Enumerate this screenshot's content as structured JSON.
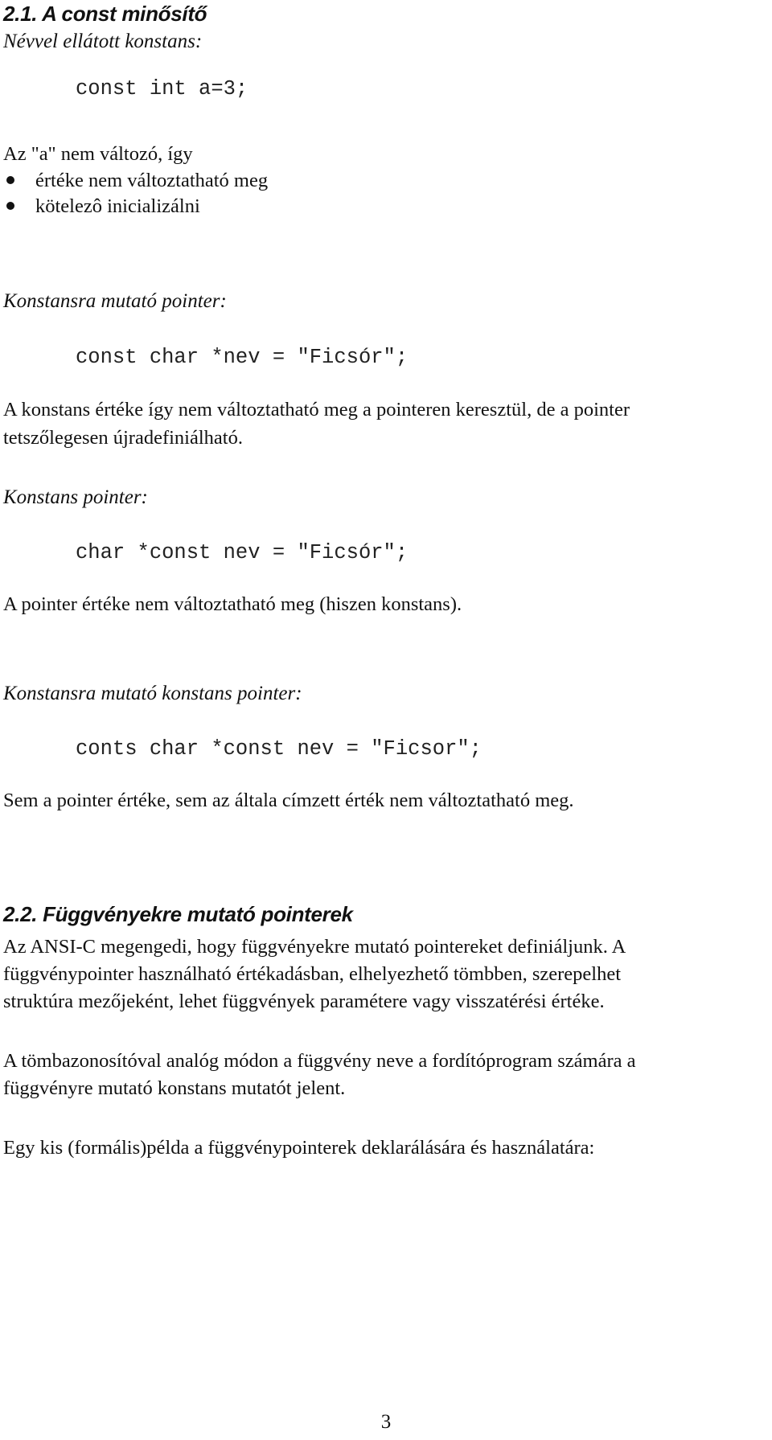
{
  "section1": {
    "heading": "2.1. A const minősítő",
    "named_constant": {
      "label": "Névvel ellátott konstans:",
      "code": "const int a=3;",
      "intro": "Az \"a\" nem változó, így",
      "bullets": [
        "értéke nem változtatható meg",
        "kötelezô inicializálni"
      ]
    },
    "pointer_to_constant": {
      "label": "Konstansra mutató pointer:",
      "code": "const char *nev = \"Ficsór\";",
      "text_line1": "A konstans értéke így nem változtatható meg a pointeren keresztül, de a pointer",
      "text_line2": "tetszőlegesen újradefiniálható."
    },
    "constant_pointer": {
      "label": "Konstans pointer:",
      "code": "char *const nev = \"Ficsór\";",
      "text": "A pointer értéke nem változtatható meg (hiszen konstans)."
    },
    "constant_pointer_to_constant": {
      "label": "Konstansra mutató konstans pointer:",
      "code": "conts char *const nev = \"Ficsor\";",
      "text": "Sem a pointer értéke, sem az általa címzett érték nem változtatható meg."
    }
  },
  "section2": {
    "heading": "2.2. Függvényekre mutató pointerek",
    "para1": [
      "Az ANSI-C megengedi, hogy függvényekre mutató pointereket definiáljunk. A",
      "függvénypointer használható értékadásban, elhelyezhető tömbben, szerepelhet",
      "struktúra mezőjeként, lehet függvények paramétere vagy visszatérési értéke."
    ],
    "para2": [
      "A tömbazonosítóval analóg módon a függvény neve a fordítóprogram számára a",
      "függvényre mutató konstans mutatót jelent."
    ],
    "para3": "Egy kis (formális)példa a függvénypointerek deklarálására és használatára:"
  },
  "footer": {
    "page_number": "3"
  }
}
